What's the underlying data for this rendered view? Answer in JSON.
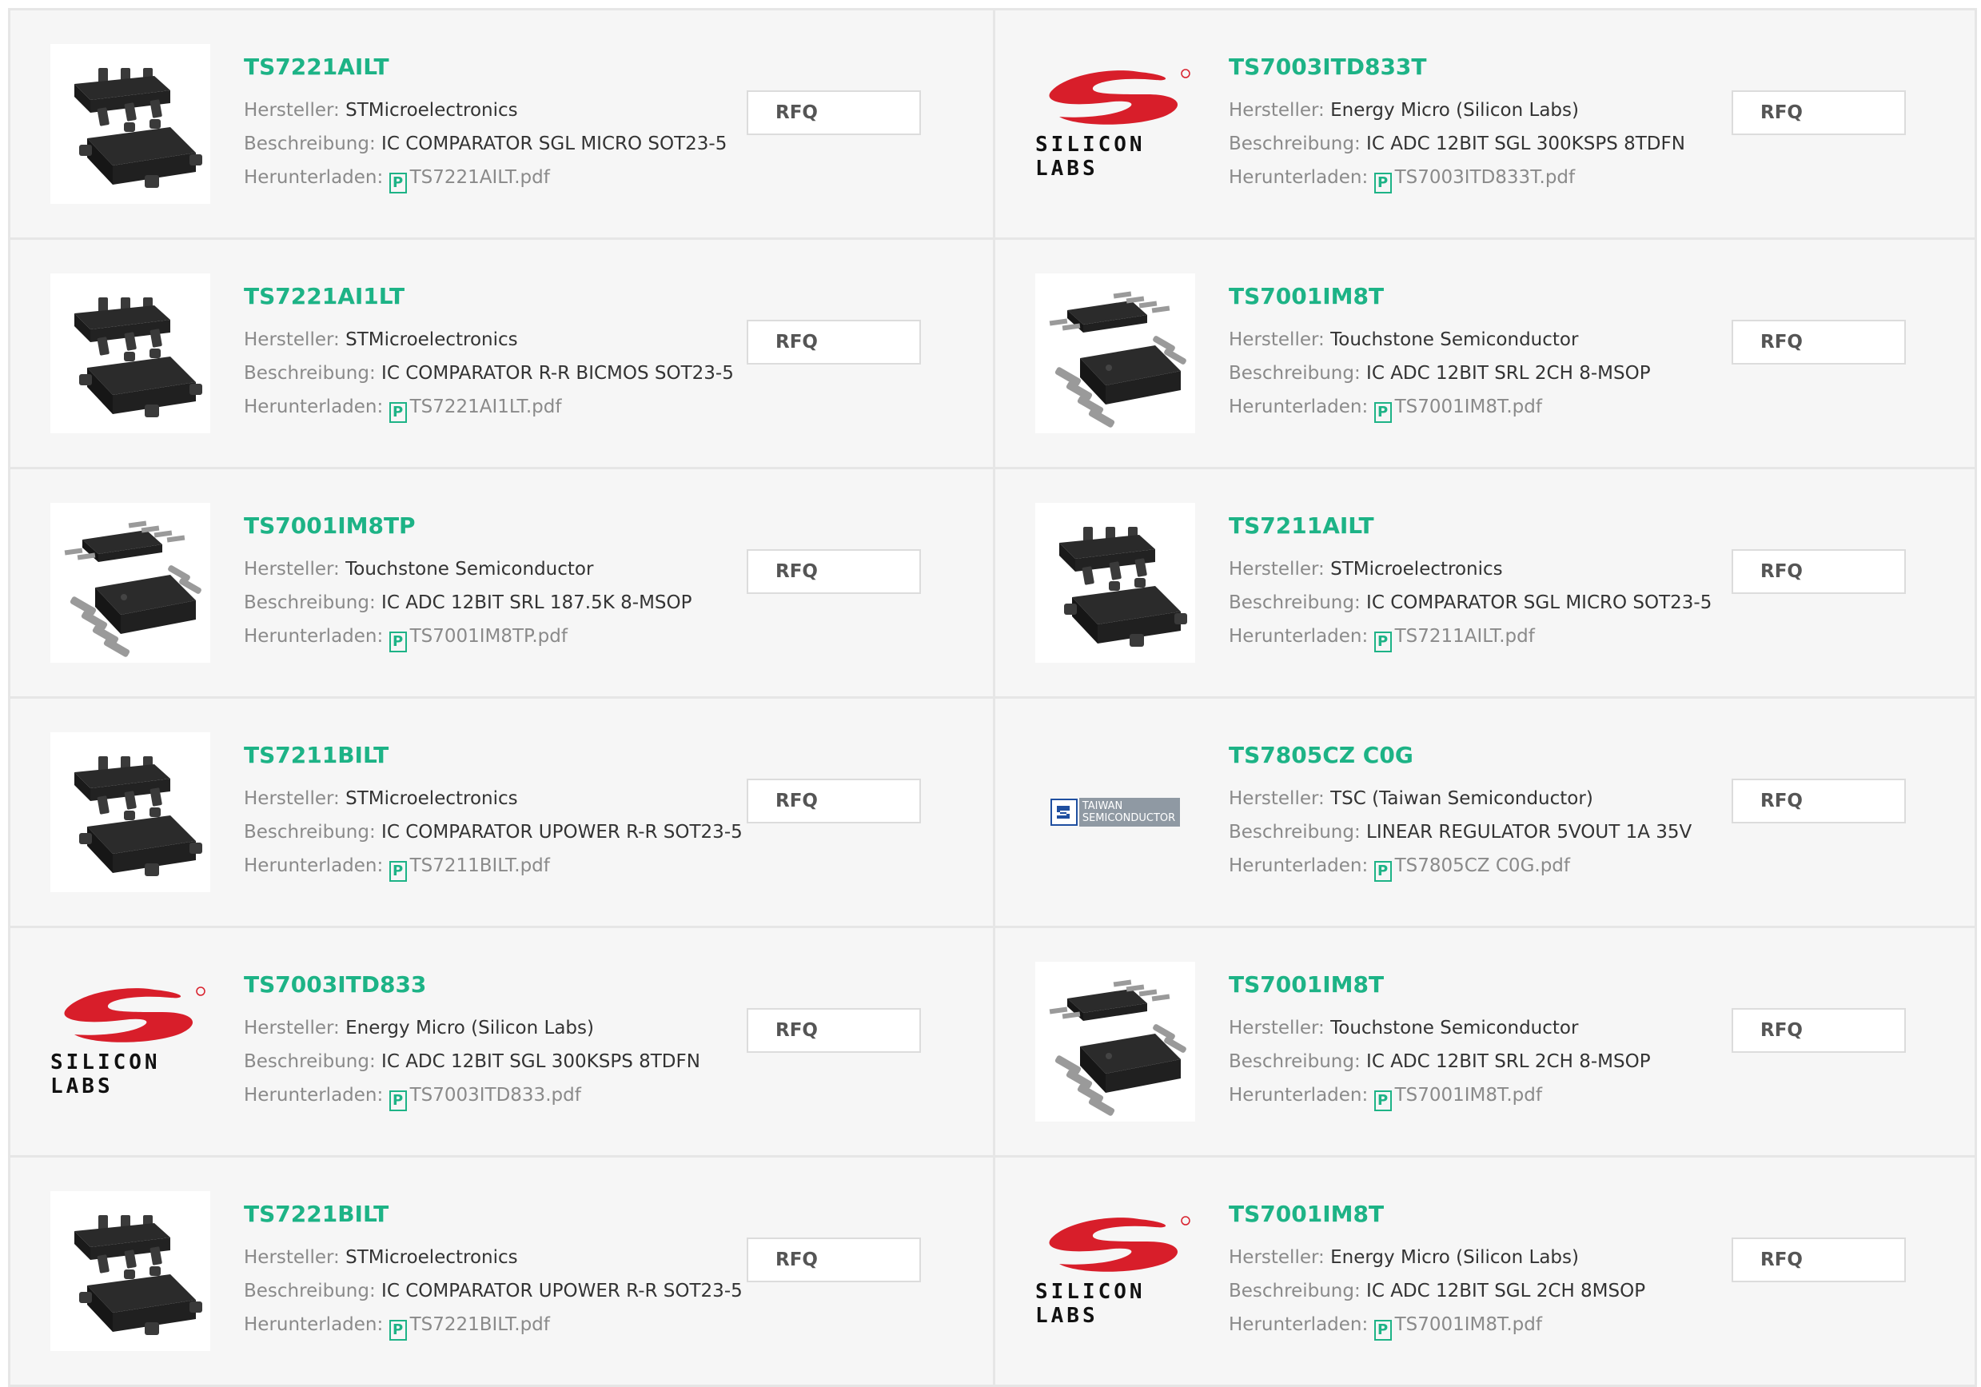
{
  "labels": {
    "manufacturer": "Hersteller:",
    "description": "Beschreibung:",
    "download": "Herunterladen:",
    "rfq": "RFQ",
    "pdf_icon": "P"
  },
  "colors": {
    "accent": "#1db386",
    "card_bg": "#f6f6f6",
    "border": "#e6e6e6",
    "silicon_labs_red": "#d81e2a",
    "tsc_gray": "#8f99a3"
  },
  "products": [
    {
      "part": "TS7221AILT",
      "manufacturer": "STMicroelectronics",
      "description": "IC COMPARATOR SGL MICRO SOT23-5",
      "pdf": "TS7221AILT.pdf",
      "image": "sot23-5-chip"
    },
    {
      "part": "TS7003ITD833T",
      "manufacturer": "Energy Micro (Silicon Labs)",
      "description": "IC ADC 12BIT SGL 300KSPS 8TDFN",
      "pdf": "TS7003ITD833T.pdf",
      "image": "silicon-labs-logo",
      "logo_text": "SILICON LABS"
    },
    {
      "part": "TS7221AI1LT",
      "manufacturer": "STMicroelectronics",
      "description": "IC COMPARATOR R-R BICMOS SOT23-5",
      "pdf": "TS7221AI1LT.pdf",
      "image": "sot23-5-chip"
    },
    {
      "part": "TS7001IM8T",
      "manufacturer": "Touchstone Semiconductor",
      "description": "IC ADC 12BIT SRL 2CH 8-MSOP",
      "pdf": "TS7001IM8T.pdf",
      "image": "msop-8-chip"
    },
    {
      "part": "TS7001IM8TP",
      "manufacturer": "Touchstone Semiconductor",
      "description": "IC ADC 12BIT SRL 187.5K 8-MSOP",
      "pdf": "TS7001IM8TP.pdf",
      "image": "msop-8-chip"
    },
    {
      "part": "TS7211AILT",
      "manufacturer": "STMicroelectronics",
      "description": "IC COMPARATOR SGL MICRO SOT23-5",
      "pdf": "TS7211AILT.pdf",
      "image": "sot23-5-chip"
    },
    {
      "part": "TS7211BILT",
      "manufacturer": "STMicroelectronics",
      "description": "IC COMPARATOR UPOWER R-R SOT23-5",
      "pdf": "TS7211BILT.pdf",
      "image": "sot23-5-chip"
    },
    {
      "part": "TS7805CZ C0G",
      "manufacturer": "TSC (Taiwan Semiconductor)",
      "description": "LINEAR REGULATOR 5VOUT 1A 35V",
      "pdf": "TS7805CZ C0G.pdf",
      "image": "taiwan-semiconductor-logo",
      "logo_text": "TAIWAN SEMICONDUCTOR"
    },
    {
      "part": "TS7003ITD833",
      "manufacturer": "Energy Micro (Silicon Labs)",
      "description": "IC ADC 12BIT SGL 300KSPS 8TDFN",
      "pdf": "TS7003ITD833.pdf",
      "image": "silicon-labs-logo",
      "logo_text": "SILICON LABS"
    },
    {
      "part": "TS7001IM8T",
      "manufacturer": "Touchstone Semiconductor",
      "description": "IC ADC 12BIT SRL 2CH 8-MSOP",
      "pdf": "TS7001IM8T.pdf",
      "image": "msop-8-chip"
    },
    {
      "part": "TS7221BILT",
      "manufacturer": "STMicroelectronics",
      "description": "IC COMPARATOR UPOWER R-R SOT23-5",
      "pdf": "TS7221BILT.pdf",
      "image": "sot23-5-chip"
    },
    {
      "part": "TS7001IM8T",
      "manufacturer": "Energy Micro (Silicon Labs)",
      "description": "IC ADC 12BIT SGL 2CH 8MSOP",
      "pdf": "TS7001IM8T.pdf",
      "image": "silicon-labs-logo",
      "logo_text": "SILICON LABS"
    }
  ]
}
